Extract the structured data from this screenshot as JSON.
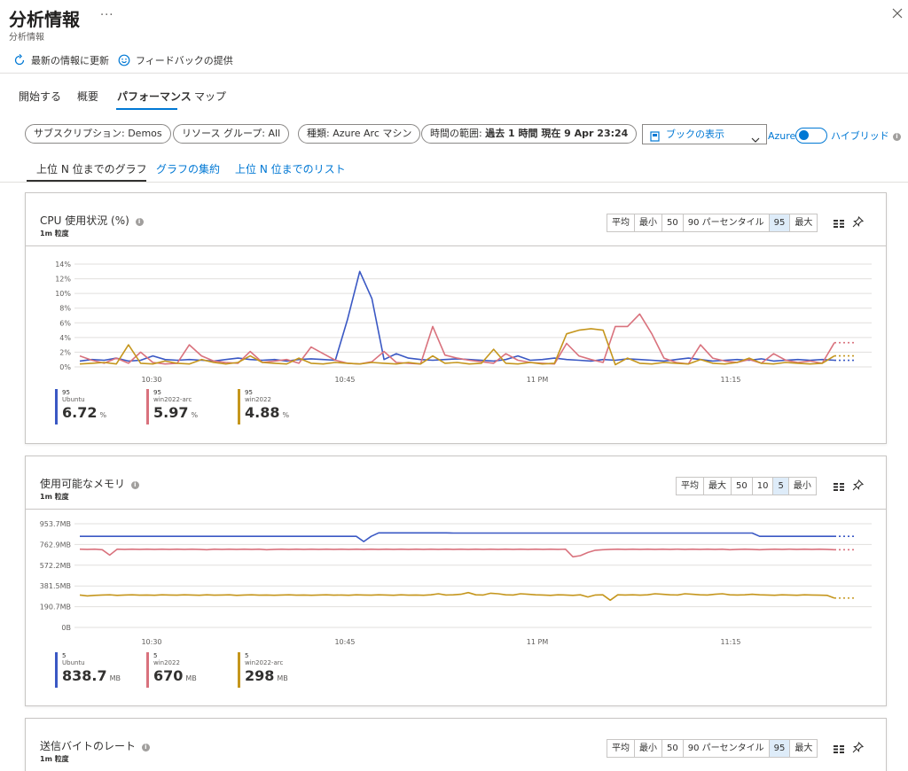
{
  "header": {
    "title": "分析情報",
    "more": "···",
    "subtitle": "分析情報"
  },
  "commands": {
    "refresh": "最新の情報に更新",
    "feedback": "フィードバックの提供"
  },
  "tabs": [
    "開始する",
    "概要",
    "パフォーマンス",
    "マップ"
  ],
  "filters": {
    "subscription": "サブスクリプション: Demos",
    "resource_group": "リソース グループ: All",
    "type": "種類: Azure Arc マシン",
    "time_label": "時間の範囲: ",
    "time_value": "過去 1 時間 現在 9 Apr 23:24"
  },
  "workbook": {
    "label": "ブックの表示"
  },
  "toggle": {
    "left_label": "Azure",
    "right_label": "ハイブリッド",
    "on": true
  },
  "subtabs": [
    "上位 N 位までのグラフ",
    "グラフの集約",
    "上位 N 位までのリスト"
  ],
  "colors": {
    "ubuntu": "#3a58c4",
    "win2022_arc": "#d9727d",
    "win2022": "#c5961d",
    "accent": "#0078d4"
  },
  "icons": [
    "refresh-icon",
    "feedback-icon",
    "close-icon",
    "book-icon",
    "chevron-down-icon",
    "grid-icon",
    "pin-icon",
    "info-icon"
  ],
  "cpu": {
    "title": "CPU 使用状況 (%)",
    "granularity": "1m 粒度",
    "segments": [
      "平均",
      "最小",
      "50",
      "90 パーセンタイル",
      "95",
      "最大"
    ],
    "selected_segment": "95",
    "legend": [
      {
        "p": "95",
        "name": "Ubuntu",
        "value": "6.72",
        "unit": "%"
      },
      {
        "p": "95",
        "name": "win2022-arc",
        "value": "5.97",
        "unit": "%"
      },
      {
        "p": "95",
        "name": "win2022",
        "value": "4.88",
        "unit": "%"
      }
    ]
  },
  "memory": {
    "title": "使用可能なメモリ",
    "granularity": "1m 粒度",
    "segments": [
      "平均",
      "最大",
      "50",
      "10",
      "5",
      "最小"
    ],
    "selected_segment": "5",
    "legend": [
      {
        "p": "5",
        "name": "Ubuntu",
        "value": "838.7",
        "unit": "MB"
      },
      {
        "p": "5",
        "name": "win2022",
        "value": "670",
        "unit": "MB"
      },
      {
        "p": "5",
        "name": "win2022-arc",
        "value": "298",
        "unit": "MB"
      }
    ]
  },
  "sent": {
    "title": "送信バイトのレート",
    "granularity": "1m 粒度",
    "segments": [
      "平均",
      "最小",
      "50",
      "90 パーセンタイル",
      "95",
      "最大"
    ],
    "selected_segment": "95"
  },
  "chart_data": [
    {
      "type": "line",
      "title": "CPU 使用状況 (%)",
      "x_tick_labels": [
        "10:30",
        "10:45",
        "11 PM",
        "11:15"
      ],
      "y_tick_labels": [
        "0%",
        "2%",
        "4%",
        "6%",
        "8%",
        "10%",
        "12%",
        "14%"
      ],
      "ylim": [
        0,
        14
      ],
      "series": [
        {
          "name": "Ubuntu",
          "color": "#3a58c4",
          "values": [
            0.8,
            1.0,
            0.9,
            1.2,
            0.8,
            0.9,
            1.5,
            1.0,
            0.9,
            1.0,
            0.9,
            0.8,
            1.0,
            1.2,
            1.0,
            0.9,
            1.0,
            0.8,
            1.0,
            1.1,
            1.0,
            0.9,
            6.5,
            13.0,
            9.3,
            1.0,
            1.8,
            1.2,
            1.0,
            0.9,
            1.0,
            1.1,
            1.0,
            0.9,
            0.8,
            1.0,
            1.5,
            0.9,
            1.0,
            1.2,
            1.0,
            0.9,
            0.8,
            1.0,
            0.9,
            1.1,
            1.0,
            0.9,
            0.8,
            1.0,
            1.2,
            1.0,
            0.8,
            0.9,
            1.0,
            0.9,
            1.1,
            0.8,
            0.9,
            1.0,
            0.9,
            1.0,
            0.9
          ]
        },
        {
          "name": "win2022-arc",
          "color": "#d9727d",
          "values": [
            1.5,
            0.9,
            0.5,
            1.2,
            0.5,
            2.0,
            0.6,
            0.4,
            0.5,
            3.0,
            1.5,
            0.8,
            0.6,
            0.5,
            2.1,
            0.6,
            0.8,
            1.0,
            0.5,
            2.7,
            1.8,
            0.9,
            0.5,
            0.4,
            0.7,
            2.1,
            0.6,
            0.5,
            0.4,
            5.5,
            1.6,
            1.2,
            0.9,
            0.7,
            0.5,
            1.8,
            0.9,
            0.6,
            0.5,
            0.4,
            3.2,
            1.5,
            1.0,
            0.6,
            5.5,
            5.5,
            7.2,
            4.5,
            1.2,
            0.6,
            0.4,
            3.0,
            1.2,
            0.8,
            0.6,
            1.0,
            0.5,
            1.8,
            0.9,
            0.6,
            0.8,
            0.5,
            3.3
          ]
        },
        {
          "name": "win2022",
          "color": "#c5961d",
          "values": [
            0.4,
            0.5,
            0.6,
            0.4,
            3.0,
            0.5,
            0.4,
            0.8,
            0.5,
            0.4,
            1.0,
            0.6,
            0.4,
            0.6,
            1.5,
            0.6,
            0.5,
            0.4,
            1.2,
            0.5,
            0.4,
            0.6,
            0.5,
            0.4,
            0.6,
            0.5,
            0.4,
            0.6,
            0.4,
            1.5,
            0.5,
            0.6,
            0.4,
            0.5,
            2.4,
            0.5,
            0.4,
            0.6,
            0.4,
            0.5,
            4.5,
            5.0,
            5.2,
            5.0,
            0.3,
            1.2,
            0.5,
            0.4,
            0.6,
            0.5,
            0.4,
            1.0,
            0.5,
            0.4,
            0.6,
            1.2,
            0.5,
            0.4,
            0.6,
            0.5,
            0.4,
            0.5,
            1.5
          ]
        }
      ]
    },
    {
      "type": "line",
      "title": "使用可能なメモリ",
      "x_tick_labels": [
        "10:30",
        "10:45",
        "11 PM",
        "11:15"
      ],
      "y_tick_labels": [
        "0B",
        "190.7MB",
        "381.5MB",
        "572.2MB",
        "762.9MB",
        "953.7MB"
      ],
      "ylim": [
        0,
        953.7
      ],
      "series": [
        {
          "name": "Ubuntu",
          "color": "#3a58c4",
          "values": [
            838,
            838,
            838,
            838,
            838,
            838,
            838,
            838,
            838,
            838,
            838,
            838,
            838,
            838,
            838,
            838,
            838,
            838,
            838,
            838,
            838,
            838,
            838,
            838,
            838,
            838,
            838,
            838,
            838,
            838,
            838,
            838,
            838,
            838,
            838,
            838,
            838,
            838,
            790,
            838,
            870,
            870,
            870,
            870,
            870,
            870,
            870,
            870,
            870,
            870,
            868,
            868,
            868,
            868,
            868,
            868,
            868,
            868,
            868,
            868,
            868,
            868,
            868,
            868,
            868,
            868,
            868,
            868,
            868,
            868,
            868,
            868,
            868,
            868,
            868,
            868,
            868,
            868,
            868,
            868,
            868,
            868,
            868,
            868,
            868,
            868,
            868,
            868,
            868,
            868,
            868,
            838,
            838,
            838,
            838,
            838,
            838,
            838,
            838,
            838,
            838,
            838
          ]
        },
        {
          "name": "win2022",
          "color": "#d9727d",
          "values": [
            720,
            718,
            720,
            715,
            665,
            720,
            718,
            720,
            718,
            720,
            718,
            720,
            718,
            720,
            718,
            720,
            718,
            715,
            720,
            718,
            720,
            718,
            720,
            718,
            720,
            715,
            718,
            720,
            718,
            720,
            718,
            720,
            718,
            720,
            718,
            720,
            718,
            720,
            718,
            720,
            718,
            720,
            718,
            720,
            718,
            720,
            718,
            720,
            718,
            720,
            718,
            720,
            718,
            720,
            718,
            720,
            718,
            720,
            718,
            720,
            718,
            720,
            718,
            720,
            718,
            720,
            650,
            660,
            690,
            710,
            715,
            718,
            720,
            718,
            720,
            718,
            720,
            718,
            720,
            718,
            720,
            718,
            720,
            718,
            720,
            718,
            720,
            715,
            718,
            720,
            718,
            715,
            718,
            720,
            718,
            720,
            718,
            720,
            718,
            720,
            718,
            715
          ]
        },
        {
          "name": "win2022-arc",
          "color": "#c5961d",
          "values": [
            298,
            290,
            295,
            298,
            300,
            295,
            298,
            300,
            297,
            298,
            296,
            300,
            298,
            297,
            300,
            298,
            296,
            300,
            297,
            298,
            300,
            295,
            298,
            300,
            297,
            298,
            296,
            298,
            300,
            297,
            298,
            296,
            298,
            300,
            297,
            298,
            296,
            300,
            298,
            297,
            300,
            298,
            296,
            300,
            297,
            298,
            296,
            300,
            310,
            298,
            300,
            305,
            320,
            300,
            298,
            315,
            310,
            300,
            298,
            310,
            305,
            300,
            298,
            295,
            300,
            298,
            295,
            300,
            280,
            298,
            300,
            250,
            300,
            298,
            300,
            297,
            300,
            310,
            305,
            300,
            298,
            310,
            305,
            300,
            298,
            305,
            310,
            300,
            298,
            300,
            305,
            300,
            298,
            296,
            300,
            298,
            296,
            300,
            298,
            297,
            295,
            270
          ]
        }
      ]
    }
  ]
}
